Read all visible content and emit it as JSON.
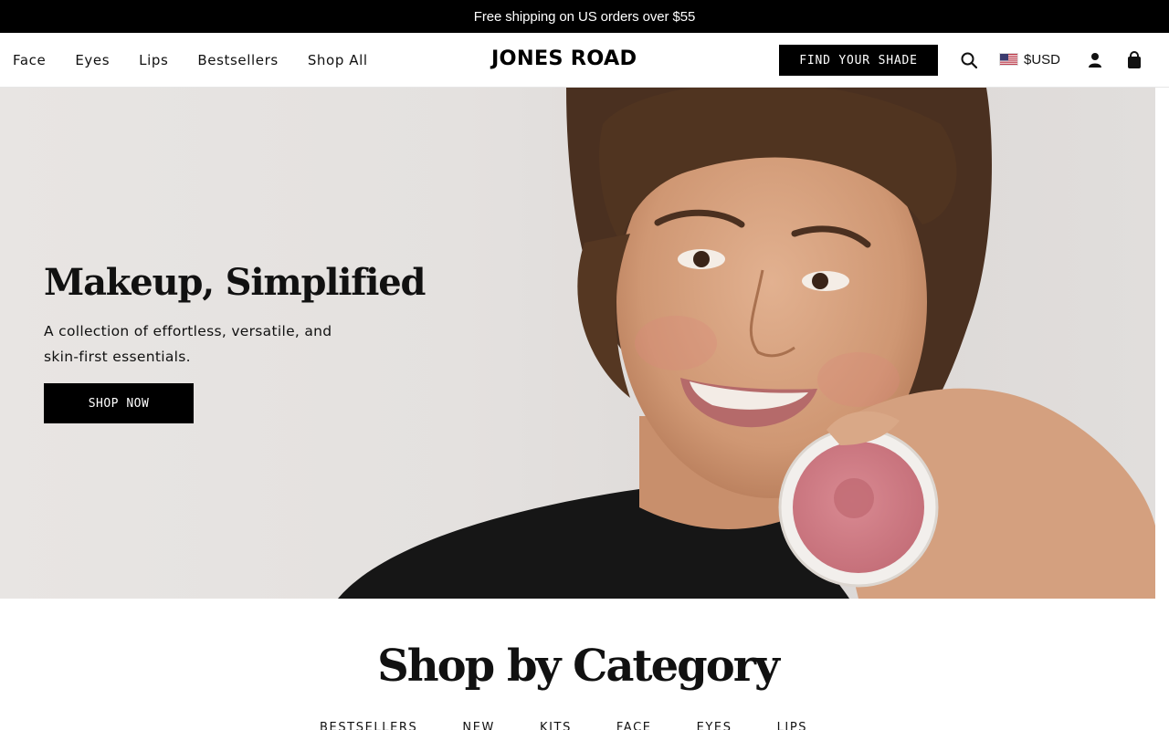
{
  "announcement": "Free shipping on US orders over $55",
  "nav": {
    "items": [
      "Face",
      "Eyes",
      "Lips",
      "Bestsellers",
      "Shop All"
    ]
  },
  "brand": "JONES ROAD",
  "header": {
    "find_shade": "FIND YOUR SHADE",
    "currency": "$USD",
    "icons": [
      "search-icon",
      "us-flag-icon",
      "account-icon",
      "cart-icon"
    ]
  },
  "hero": {
    "title": "Makeup, Simplified",
    "subtitle": "A collection of effortless, versatile, and skin-first essentials.",
    "cta": "SHOP NOW"
  },
  "categories": {
    "title": "Shop by Category",
    "tabs": [
      "BESTSELLERS",
      "NEW",
      "KITS",
      "FACE",
      "EYES",
      "LIPS"
    ]
  },
  "colors": {
    "accent": "#000000",
    "hero_bg": "#e5e2e0",
    "blush": "#d98a92"
  }
}
